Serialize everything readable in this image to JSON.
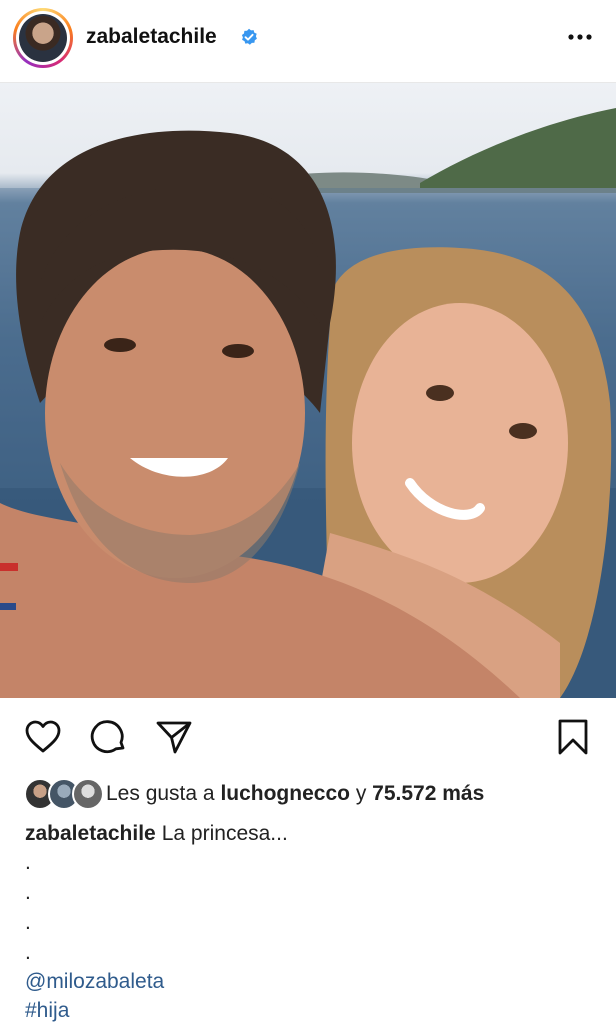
{
  "post": {
    "username": "zabaletachile",
    "verified": true,
    "more_icon": "more-horizontal-icon"
  },
  "actions": {
    "like_icon": "heart-icon",
    "comment_icon": "comment-icon",
    "share_icon": "send-icon",
    "save_icon": "bookmark-icon"
  },
  "likes": {
    "prefix": "Les gusta a",
    "user": "luchognecco",
    "connector": "y",
    "count": "75.572 más"
  },
  "caption": {
    "username": "zabaletachile",
    "text": "La princesa...",
    "dots": [
      ".",
      ".",
      ".",
      "."
    ],
    "mention": "@milozabaleta",
    "hashtag": "#hija"
  },
  "colors": {
    "link": "#2f5b8c",
    "verified": "#3897f0"
  }
}
